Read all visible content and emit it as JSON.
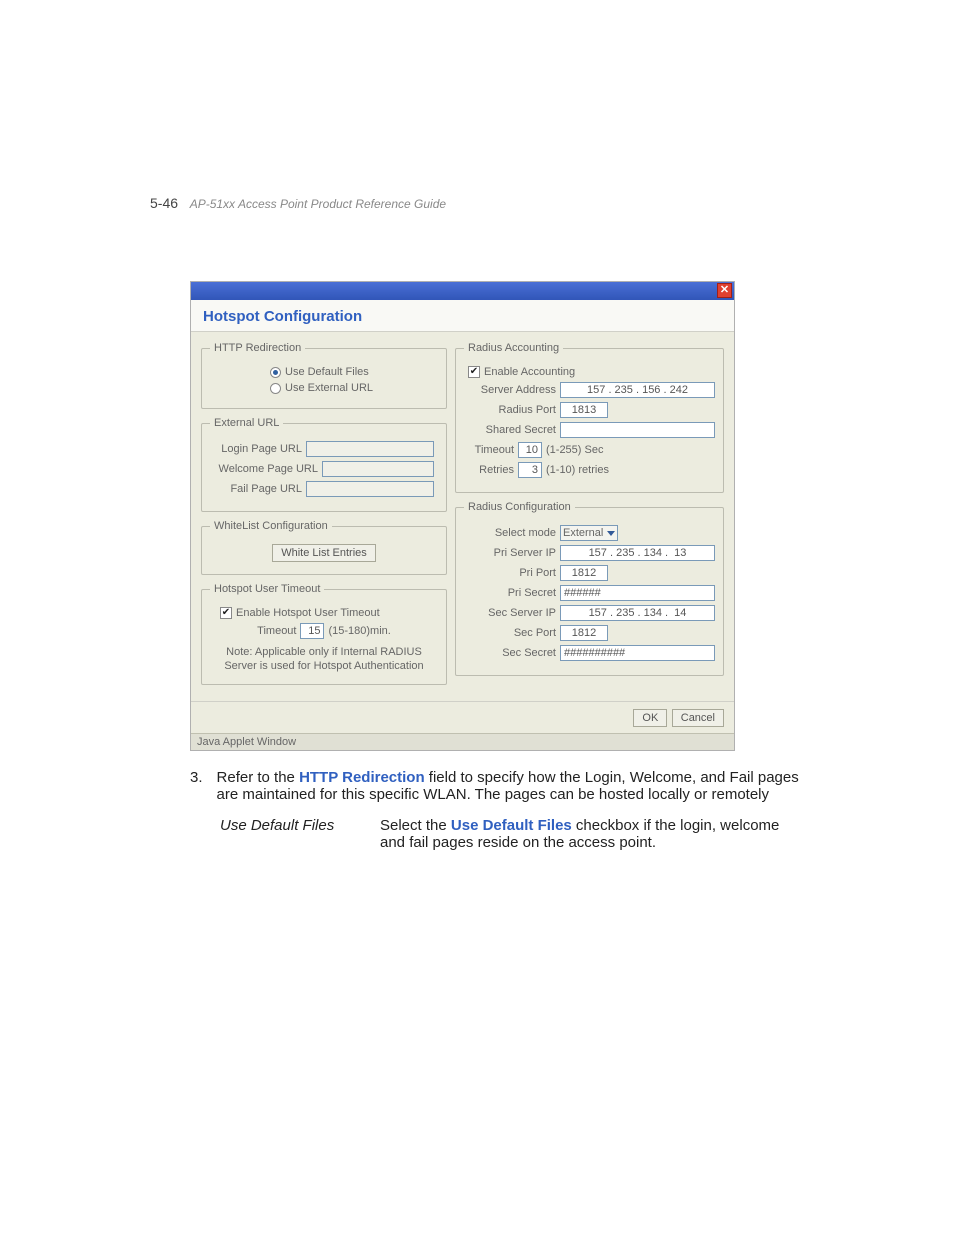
{
  "page": {
    "number": "5-46",
    "header": "AP-51xx Access Point Product Reference Guide"
  },
  "dialog": {
    "title": "Hotspot Configuration",
    "status": "Java Applet Window",
    "ok": "OK",
    "cancel": "Cancel"
  },
  "http_redir": {
    "legend": "HTTP Redirection",
    "use_default": "Use Default Files",
    "use_external": "Use External URL"
  },
  "ext_url": {
    "legend": "External URL",
    "login": "Login Page URL",
    "welcome": "Welcome Page URL",
    "fail": "Fail Page URL"
  },
  "whitelist": {
    "legend": "WhiteList Configuration",
    "button": "White List Entries"
  },
  "timeout": {
    "legend": "Hotspot User Timeout",
    "enable": "Enable Hotspot User Timeout",
    "timeout_label": "Timeout",
    "timeout_value": "15",
    "timeout_unit": "(15-180)min.",
    "note": "Note: Applicable only if Internal RADIUS Server is used for Hotspot Authentication"
  },
  "acct": {
    "legend": "Radius Accounting",
    "enable": "Enable Accounting",
    "server_label": "Server Address",
    "server_value": "157 . 235 . 156 . 242",
    "port_label": "Radius Port",
    "port_value": "1813",
    "secret_label": "Shared Secret",
    "secret_value": "",
    "timeout_label": "Timeout",
    "timeout_value": "10",
    "timeout_unit": "(1-255) Sec",
    "retries_label": "Retries",
    "retries_value": "3",
    "retries_unit": "(1-10) retries"
  },
  "config": {
    "legend": "Radius Configuration",
    "mode_label": "Select mode",
    "mode_value": "External",
    "pri_ip_label": "Pri Server IP",
    "pri_ip_value": "157 . 235 . 134 .  13",
    "pri_port_label": "Pri Port",
    "pri_port_value": "1812",
    "pri_secret_label": "Pri Secret",
    "pri_secret_value": "######",
    "sec_ip_label": "Sec Server IP",
    "sec_ip_value": "157 . 235 . 134 .  14",
    "sec_port_label": "Sec Port",
    "sec_port_value": "1812",
    "sec_secret_label": "Sec Secret",
    "sec_secret_value": "##########"
  },
  "body": {
    "item_num": "3.",
    "item_text_pre": "Refer to the ",
    "item_link": "HTTP Redirection",
    "item_text_post": " field to specify how the Login, Welcome, and Fail pages are maintained for this specific WLAN. The pages can be hosted locally or remotely",
    "def_term": "Use Default Files",
    "def_pre": "Select the ",
    "def_link": "Use Default Files",
    "def_post": " checkbox if the login, welcome and fail pages reside on the access point."
  }
}
